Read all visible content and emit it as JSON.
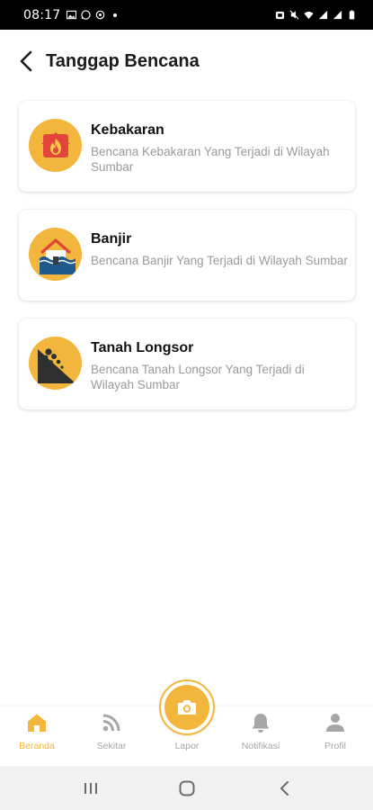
{
  "status_bar": {
    "time": "08:17",
    "left_icons": [
      "image-icon",
      "whatsapp-icon",
      "sync-icon",
      "dot-icon"
    ],
    "right_icons": [
      "alarm-icon",
      "mute-icon",
      "wifi-icon",
      "signal-icon",
      "signal-icon",
      "battery-icon"
    ]
  },
  "header": {
    "title": "Tanggap Bencana",
    "back_icon": "chevron-left-icon"
  },
  "cards": [
    {
      "title": "Kebakaran",
      "description": "Bencana Kebakaran Yang Terjadi di Wilayah Sumbar",
      "icon": "fire-icon"
    },
    {
      "title": "Banjir",
      "description": "Bencana Banjir Yang Terjadi di Wilayah Sumbar",
      "icon": "flood-icon"
    },
    {
      "title": "Tanah Longsor",
      "description": "Bencana Tanah Longsor Yang Terjadi di Wilayah Sumbar",
      "icon": "landslide-icon"
    }
  ],
  "bottom_nav": {
    "items": [
      {
        "label": "Beranda",
        "icon": "home-icon",
        "active": true
      },
      {
        "label": "Sekitar",
        "icon": "rss-icon",
        "active": false
      },
      {
        "label": "Lapor",
        "icon": "camera-icon",
        "active": false
      },
      {
        "label": "Notifikasi",
        "icon": "bell-icon",
        "active": false
      },
      {
        "label": "Profil",
        "icon": "person-icon",
        "active": false
      }
    ]
  },
  "system_nav": [
    "recents-icon",
    "home-circle-icon",
    "back-icon"
  ],
  "colors": {
    "accent": "#f2b63c",
    "title_text": "#1b1b1b",
    "secondary_text": "#9a9a9a",
    "nav_inactive": "#a6a6a6",
    "fire_red": "#e2453a",
    "dark_icon": "#2f2f2f"
  }
}
